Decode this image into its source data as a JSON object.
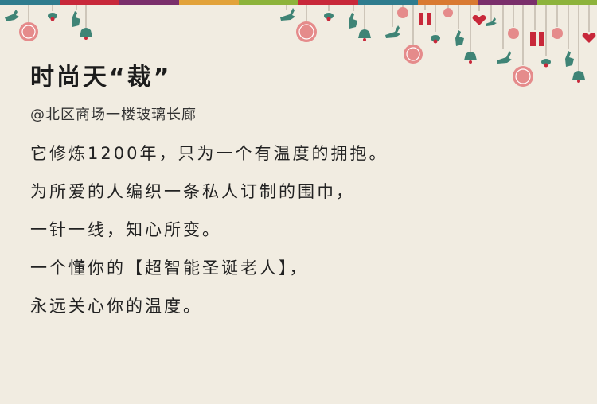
{
  "header": {
    "title": "时尚天“裁”",
    "subtitle": "@北区商场一楼玻璃长廊"
  },
  "body": {
    "lines": [
      "它修炼1200年，只为一个有温度的拥抱。",
      "为所爱的人编织一条私人订制的围巾，",
      "一针一线，知心所变。",
      "一个懂你的【超智能圣诞老人】，",
      "永远关心你的温度。"
    ]
  },
  "colors": {
    "background": "#f1ece1",
    "decoration_red": "#c8283a",
    "decoration_pink": "#e58b8b",
    "decoration_teal": "#3f8476",
    "stripe": [
      "#2f7c8e",
      "#c8283a",
      "#7a2f6b",
      "#e2a23a",
      "#8db33b",
      "#c8283a",
      "#2f7c8e",
      "#d97a32",
      "#7a2f6b",
      "#8db33b"
    ]
  },
  "decorations": [
    "stripe-band",
    "snowflake-ornament-icon",
    "reindeer-icon",
    "gift-box-icon",
    "heart-icon",
    "holly-icon",
    "bell-icon"
  ]
}
